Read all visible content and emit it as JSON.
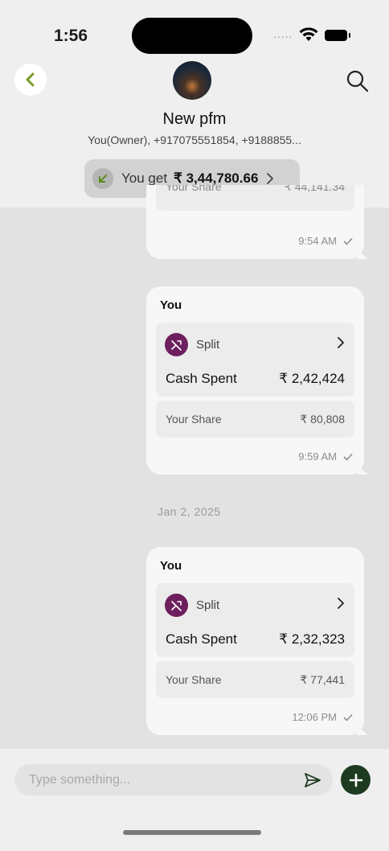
{
  "status_bar": {
    "time": "1:56",
    "signal": "....."
  },
  "header": {
    "group_name": "New pfm",
    "members": "You(Owner), +917075551854, +9188855...",
    "balance": {
      "label": "You get",
      "amount": "₹ 3,44,780.66"
    }
  },
  "messages": [
    {
      "partial_share_label": "Your Share",
      "partial_share_amount": "₹ 44,141.34",
      "time": "9:54 AM"
    },
    {
      "sender": "You",
      "type_label": "Split",
      "cash_label": "Cash Spent",
      "cash_amount": "₹ 2,42,424",
      "share_label": "Your Share",
      "share_amount": "₹ 80,808",
      "time": "9:59 AM"
    },
    {
      "sender": "You",
      "type_label": "Split",
      "cash_label": "Cash Spent",
      "cash_amount": "₹ 2,32,323",
      "share_label": "Your Share",
      "share_amount": "₹ 77,441",
      "time": "12:06 PM"
    }
  ],
  "date_separator": "Jan 2, 2025",
  "composer": {
    "placeholder": "Type something..."
  },
  "colors": {
    "split_icon": "#6d1f5e",
    "add_button": "#1e3b21",
    "back_chevron": "#7a9a2a",
    "balance_arrow": "#5a8a1a"
  }
}
